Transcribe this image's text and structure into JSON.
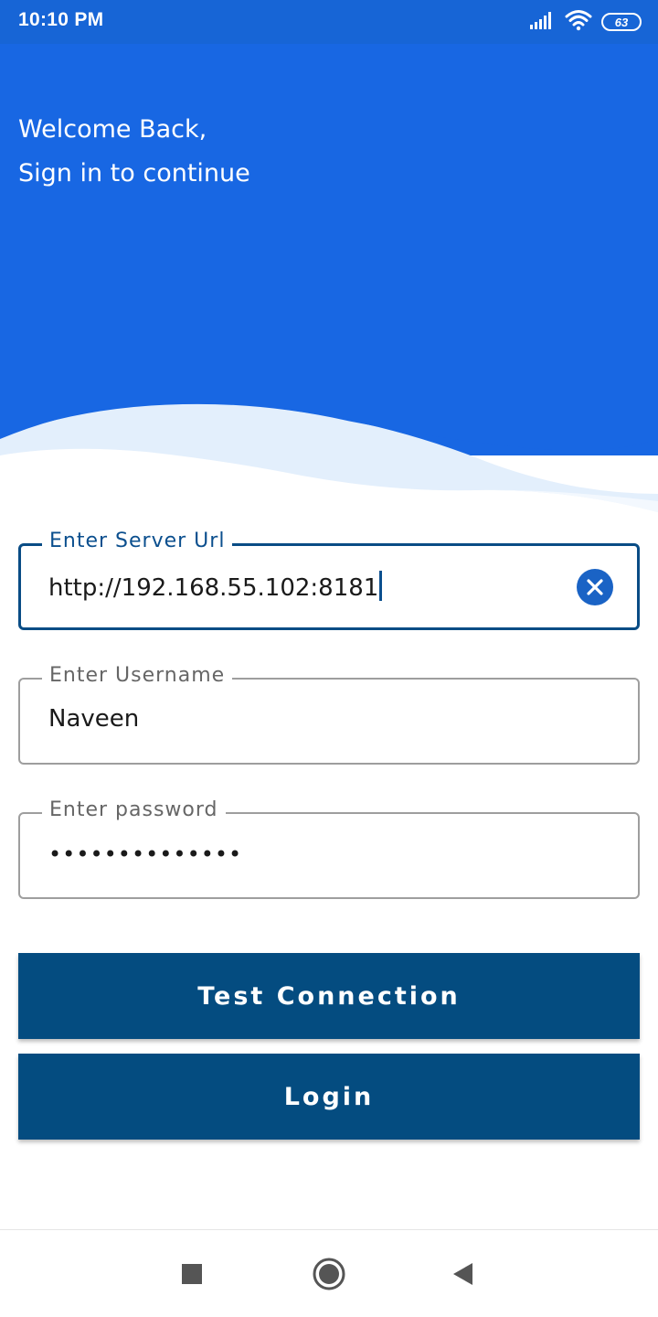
{
  "status_bar": {
    "time": "10:10 PM",
    "battery_level": "63",
    "icons": [
      "signal-icon",
      "wifi-icon",
      "battery-icon"
    ]
  },
  "header": {
    "welcome_line": "Welcome Back,",
    "subtitle_line": "Sign in to continue"
  },
  "form": {
    "server_url": {
      "label": "Enter Server Url",
      "value": "http://192.168.55.102:8181",
      "focused": true
    },
    "username": {
      "label": "Enter Username",
      "value": "Naveen"
    },
    "password": {
      "label": "Enter password",
      "value": "••••••••••••••"
    }
  },
  "buttons": {
    "test_connection": "Test Connection",
    "login": "Login"
  },
  "navigation": {
    "items": [
      "recents-square-icon",
      "home-circle-icon",
      "back-triangle-icon"
    ]
  },
  "colors": {
    "header_blue": "#1867e3",
    "status_blue": "#1765d6",
    "button_navy": "#044c80",
    "focus_border": "#094c85",
    "wave_light": "#e3effc"
  }
}
